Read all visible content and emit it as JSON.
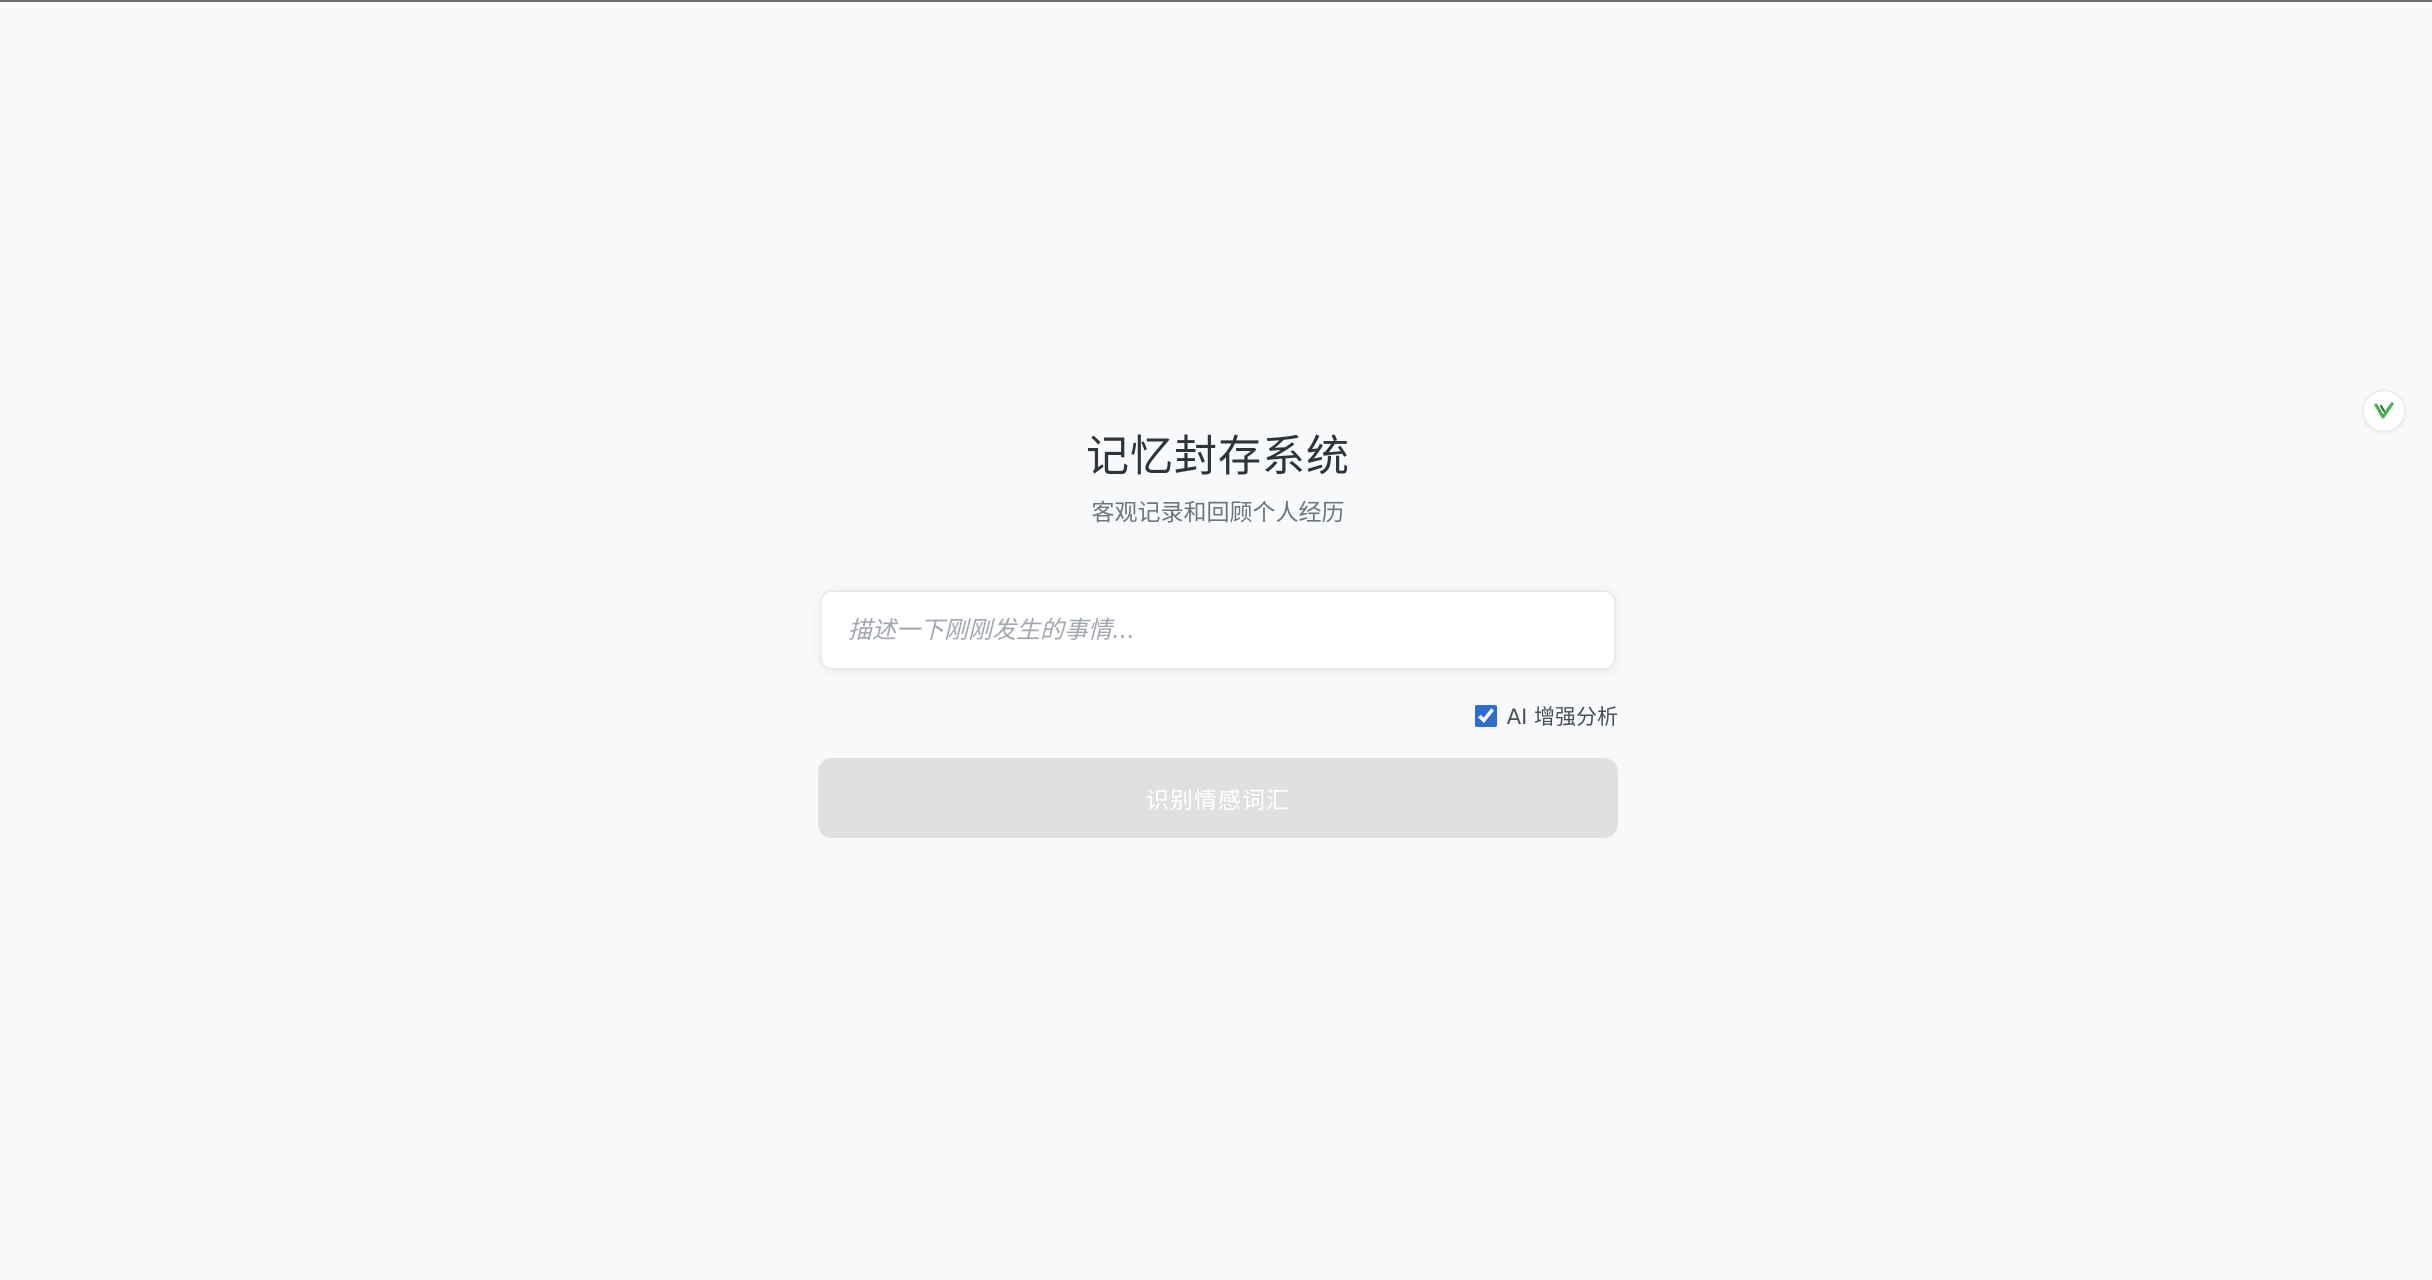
{
  "page": {
    "title": "记忆封存系统",
    "subtitle": "客观记录和回顾个人经历"
  },
  "event_input": {
    "value": "",
    "placeholder": "描述一下刚刚发生的事情..."
  },
  "ai_option": {
    "label": "AI 增强分析",
    "checked": true
  },
  "submit": {
    "label": "识别情感词汇",
    "disabled": true
  },
  "floating_badge": {
    "icon": "v-check-icon"
  },
  "colors": {
    "background": "#f8f9fb",
    "title": "#2f3439",
    "subtitle": "#6f757c",
    "placeholder": "#a2a8b0",
    "checkbox_accent": "#2f6ccf",
    "button_disabled": "#e0e0e2",
    "badge_icon": "#4caf50"
  }
}
